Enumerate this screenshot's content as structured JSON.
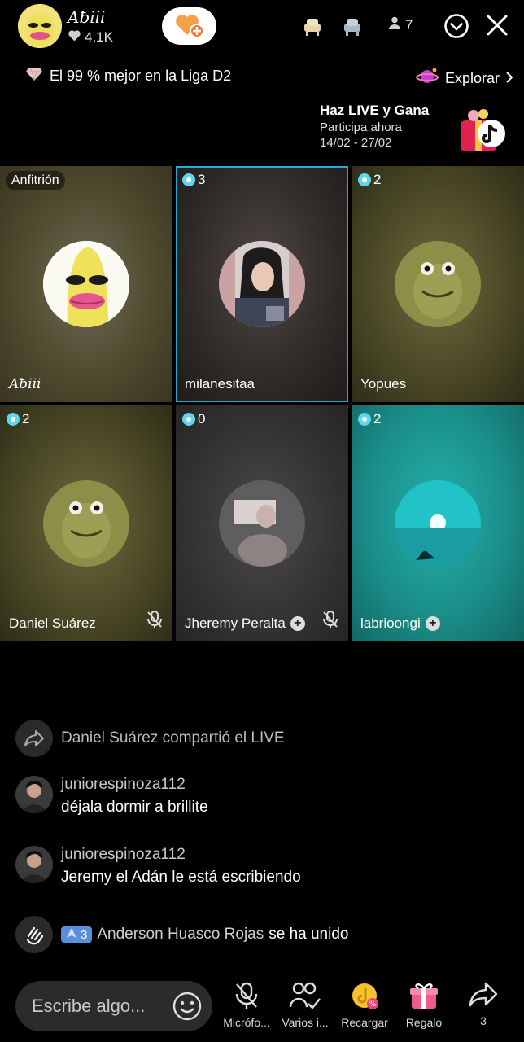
{
  "header": {
    "host_name": "Aƀiii",
    "likes": "4.1K",
    "viewers": "7"
  },
  "league": {
    "text": "El 99 % mejor en la Liga D2"
  },
  "explore": {
    "label": "Explorar"
  },
  "promo": {
    "title": "Haz LIVE y Gana",
    "subtitle": "Participa ahora",
    "dates": "14/02 - 27/02"
  },
  "tiles": [
    {
      "name": "Aƀiii",
      "tag": "Anfitrión"
    },
    {
      "name": "milanesitaa",
      "count": "3"
    },
    {
      "name": "Yopues",
      "count": "2"
    },
    {
      "name": "Daniel Suárez",
      "count": "2"
    },
    {
      "name": "Jheremy Peralta",
      "count": "0"
    },
    {
      "name": "labrioongi",
      "count": "2"
    }
  ],
  "chat": {
    "share_user": "Daniel Suárez",
    "share_text": "compartió el LIVE",
    "messages": [
      {
        "user": "juniorespinoza112",
        "text": "déjala dormir a brillite"
      },
      {
        "user": "juniorespinoza112",
        "text": "Jeremy el Adán le está escribiendo"
      }
    ],
    "join_level": "3",
    "join_user": "Anderson Huasco Rojas",
    "join_text": "se ha unido"
  },
  "bottom": {
    "placeholder": "Escribe algo...",
    "mic_label": "Micrófo...",
    "multi_label": "Varios i...",
    "recharge_label": "Recargar",
    "gift_label": "Regalo",
    "share_count": "3"
  },
  "colors": {
    "accent_teal": "#5fd7ea",
    "selected_border": "#2aa7d6",
    "follow_heart": "#f6a04a"
  }
}
